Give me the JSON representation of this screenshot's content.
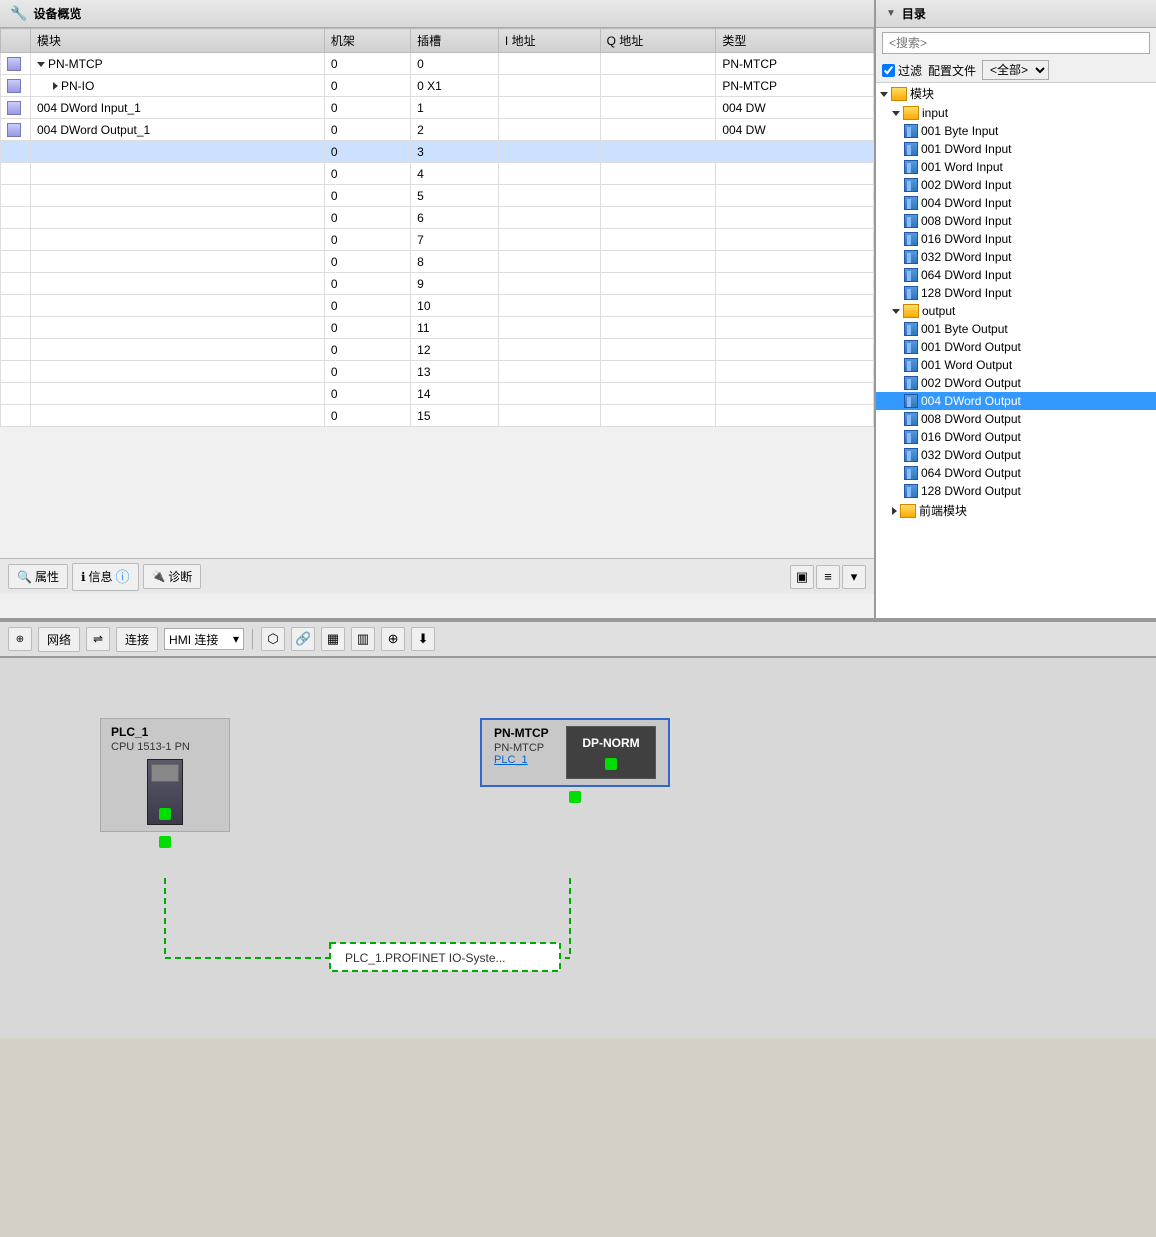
{
  "deviceOverview": {
    "title": "设备概览",
    "columns": [
      "模块",
      "机架",
      "插槽",
      "I 地址",
      "Q 地址",
      "类型"
    ],
    "rows": [
      {
        "module": "PN-MTCP",
        "rack": "0",
        "slot": "0",
        "i_addr": "",
        "q_addr": "",
        "type": "PN-MTCP",
        "indent": 0,
        "hasArrowDown": true,
        "icon": "module"
      },
      {
        "module": "PN-IO",
        "rack": "0",
        "slot": "0 X1",
        "i_addr": "",
        "q_addr": "",
        "type": "PN-MTCP",
        "indent": 1,
        "hasArrowRight": true,
        "icon": "module"
      },
      {
        "module": "004 DWord Input_1",
        "rack": "0",
        "slot": "1",
        "i_addr": "",
        "q_addr": "",
        "type": "004 DW",
        "indent": 0,
        "icon": "module"
      },
      {
        "module": "004 DWord Output_1",
        "rack": "0",
        "slot": "2",
        "i_addr": "",
        "q_addr": "",
        "type": "004 DW",
        "indent": 0,
        "icon": "module"
      },
      {
        "module": "",
        "rack": "0",
        "slot": "3",
        "i_addr": "",
        "q_addr": "",
        "type": "",
        "selected": true
      },
      {
        "module": "",
        "rack": "0",
        "slot": "4",
        "i_addr": "",
        "q_addr": "",
        "type": ""
      },
      {
        "module": "",
        "rack": "0",
        "slot": "5",
        "i_addr": "",
        "q_addr": "",
        "type": ""
      },
      {
        "module": "",
        "rack": "0",
        "slot": "6",
        "i_addr": "",
        "q_addr": "",
        "type": ""
      },
      {
        "module": "",
        "rack": "0",
        "slot": "7",
        "i_addr": "",
        "q_addr": "",
        "type": ""
      },
      {
        "module": "",
        "rack": "0",
        "slot": "8",
        "i_addr": "",
        "q_addr": "",
        "type": ""
      },
      {
        "module": "",
        "rack": "0",
        "slot": "9",
        "i_addr": "",
        "q_addr": "",
        "type": ""
      },
      {
        "module": "",
        "rack": "0",
        "slot": "10",
        "i_addr": "",
        "q_addr": "",
        "type": ""
      },
      {
        "module": "",
        "rack": "0",
        "slot": "11",
        "i_addr": "",
        "q_addr": "",
        "type": ""
      },
      {
        "module": "",
        "rack": "0",
        "slot": "12",
        "i_addr": "",
        "q_addr": "",
        "type": ""
      },
      {
        "module": "",
        "rack": "0",
        "slot": "13",
        "i_addr": "",
        "q_addr": "",
        "type": ""
      },
      {
        "module": "",
        "rack": "0",
        "slot": "14",
        "i_addr": "",
        "q_addr": "",
        "type": ""
      },
      {
        "module": "",
        "rack": "0",
        "slot": "15",
        "i_addr": "",
        "q_addr": "",
        "type": ""
      }
    ]
  },
  "bottomToolbar": {
    "properties": "属性",
    "info": "信息",
    "diagnostics": "诊断"
  },
  "catalog": {
    "title": "目录",
    "searchPlaceholder": "<搜索>",
    "filterLabel": "过滤",
    "profileLabel": "配置文件",
    "profileValue": "<全部>",
    "tree": [
      {
        "label": "模块",
        "indent": 0,
        "type": "folder",
        "open": true
      },
      {
        "label": "input",
        "indent": 1,
        "type": "folder",
        "open": true
      },
      {
        "label": "001 Byte Input",
        "indent": 2,
        "type": "module"
      },
      {
        "label": "001 DWord Input",
        "indent": 2,
        "type": "module"
      },
      {
        "label": "001 Word Input",
        "indent": 2,
        "type": "module"
      },
      {
        "label": "002 DWord Input",
        "indent": 2,
        "type": "module"
      },
      {
        "label": "004 DWord Input",
        "indent": 2,
        "type": "module"
      },
      {
        "label": "008 DWord Input",
        "indent": 2,
        "type": "module"
      },
      {
        "label": "016 DWord Input",
        "indent": 2,
        "type": "module"
      },
      {
        "label": "032 DWord Input",
        "indent": 2,
        "type": "module"
      },
      {
        "label": "064 DWord Input",
        "indent": 2,
        "type": "module"
      },
      {
        "label": "128 DWord Input",
        "indent": 2,
        "type": "module"
      },
      {
        "label": "output",
        "indent": 1,
        "type": "folder",
        "open": true
      },
      {
        "label": "001 Byte Output",
        "indent": 2,
        "type": "module"
      },
      {
        "label": "001 DWord Output",
        "indent": 2,
        "type": "module"
      },
      {
        "label": "001 Word Output",
        "indent": 2,
        "type": "module"
      },
      {
        "label": "002 DWord Output",
        "indent": 2,
        "type": "module"
      },
      {
        "label": "004 DWord Output",
        "indent": 2,
        "type": "module",
        "selected": true
      },
      {
        "label": "008 DWord Output",
        "indent": 2,
        "type": "module"
      },
      {
        "label": "016 DWord Output",
        "indent": 2,
        "type": "module"
      },
      {
        "label": "032 DWord Output",
        "indent": 2,
        "type": "module"
      },
      {
        "label": "064 DWord Output",
        "indent": 2,
        "type": "module"
      },
      {
        "label": "128 DWord Output",
        "indent": 2,
        "type": "module"
      },
      {
        "label": "前端模块",
        "indent": 1,
        "type": "folder",
        "open": false
      }
    ]
  },
  "networkToolbar": {
    "network": "网络",
    "connect": "连接",
    "hmiConnect": "HMI 连接"
  },
  "network": {
    "plc": {
      "name": "PLC_1",
      "cpu": "CPU 1513-1 PN"
    },
    "pnMtcp": {
      "name": "PN-MTCP",
      "sub": "PN-MTCP",
      "link": "PLC_1"
    },
    "dpNorm": "DP-NORM",
    "networkLabel": "PLC_1.PROFINET IO-Syste..."
  },
  "icons": {
    "wrench": "🔧",
    "chevronDown": "▼",
    "chevronRight": "▶",
    "search": "🔍",
    "info": "ℹ",
    "folder": "📁",
    "folderOpen": "📂",
    "scrollUp": "▲",
    "scrollDown": "▼",
    "zoomIn": "⊕",
    "download": "⬇"
  }
}
